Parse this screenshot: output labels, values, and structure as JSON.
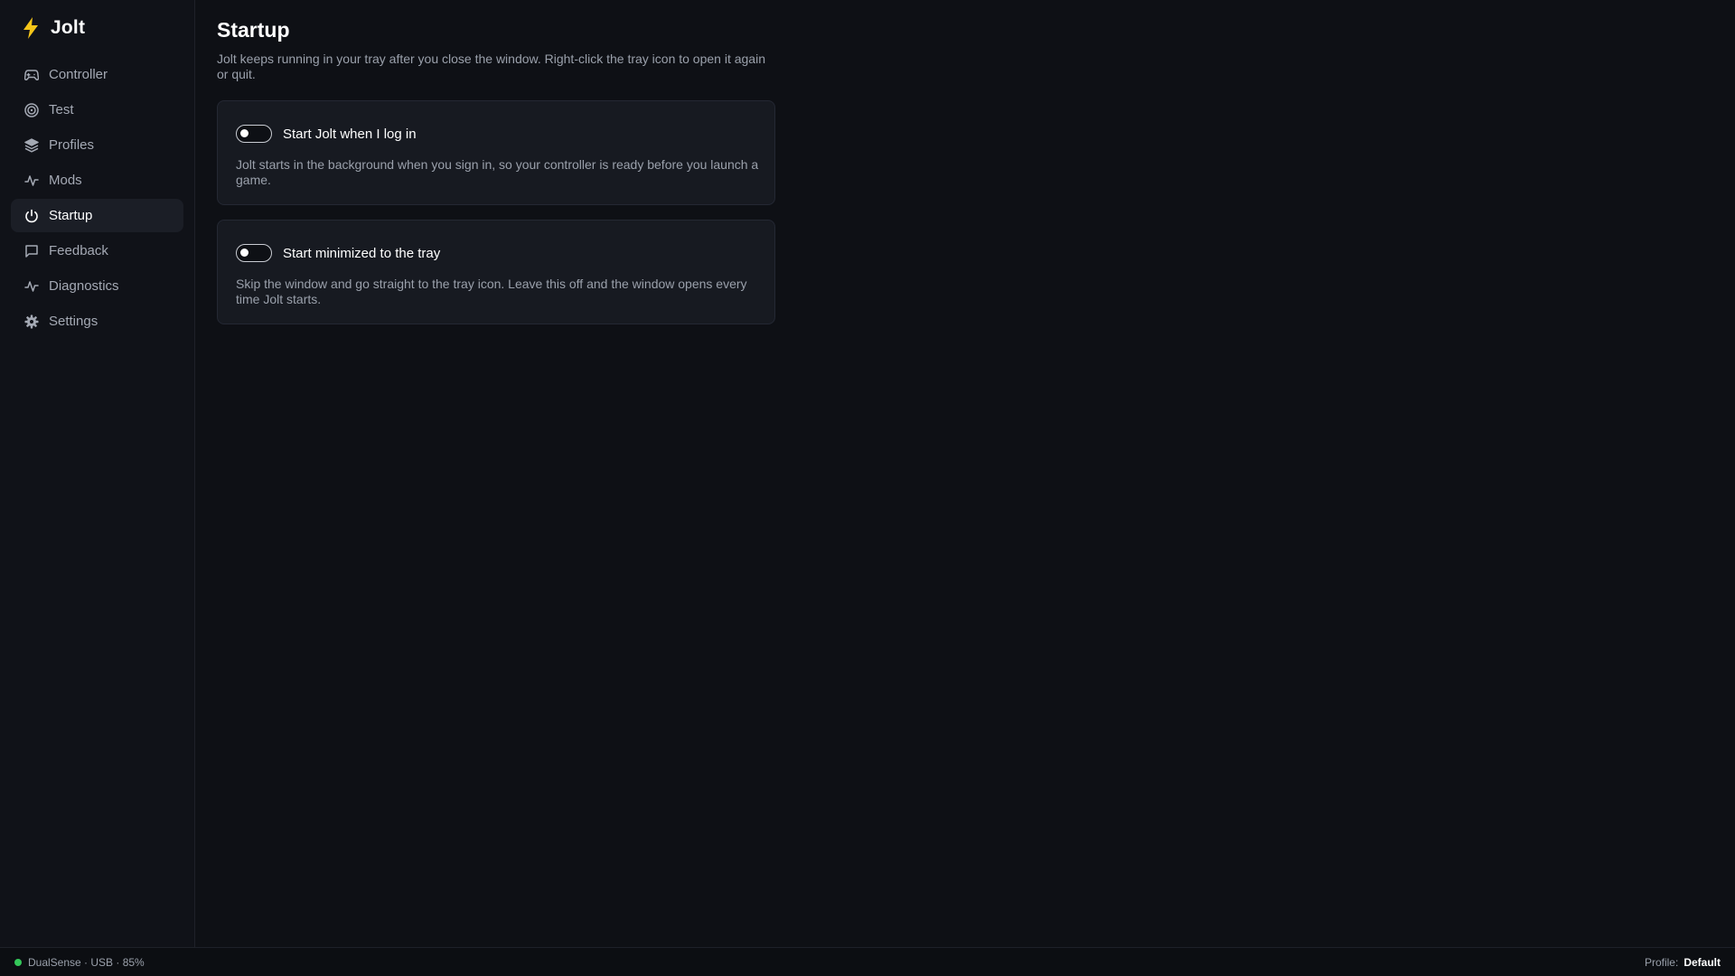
{
  "app": {
    "name": "Jolt",
    "accent_color": "#f5c518"
  },
  "sidebar": {
    "items": [
      {
        "label": "Controller",
        "icon": "gamepad-icon",
        "active": false
      },
      {
        "label": "Test",
        "icon": "target-icon",
        "active": false
      },
      {
        "label": "Profiles",
        "icon": "layers-icon",
        "active": false
      },
      {
        "label": "Mods",
        "icon": "activity-icon",
        "active": false
      },
      {
        "label": "Startup",
        "icon": "power-icon",
        "active": true
      },
      {
        "label": "Feedback",
        "icon": "message-square-icon",
        "active": false
      },
      {
        "label": "Diagnostics",
        "icon": "activity-icon",
        "active": false
      },
      {
        "label": "Settings",
        "icon": "gear-icon",
        "active": false
      }
    ]
  },
  "main": {
    "title": "Startup",
    "description": "Jolt keeps running in your tray after you close the window. Right-click the tray icon to open it again or quit.",
    "options": [
      {
        "label": "Start Jolt when I log in",
        "description": "Jolt starts in the background when you sign in, so your controller is ready before you launch a game.",
        "enabled": false
      },
      {
        "label": "Start minimized to the tray",
        "description": "Skip the window and go straight to the tray icon. Leave this off and the window opens every time Jolt starts.",
        "enabled": false
      }
    ]
  },
  "statusbar": {
    "device": "DualSense · USB · 85%",
    "device_status_color": "#34c759",
    "profile_label": "Profile:",
    "profile_value": "Default"
  }
}
